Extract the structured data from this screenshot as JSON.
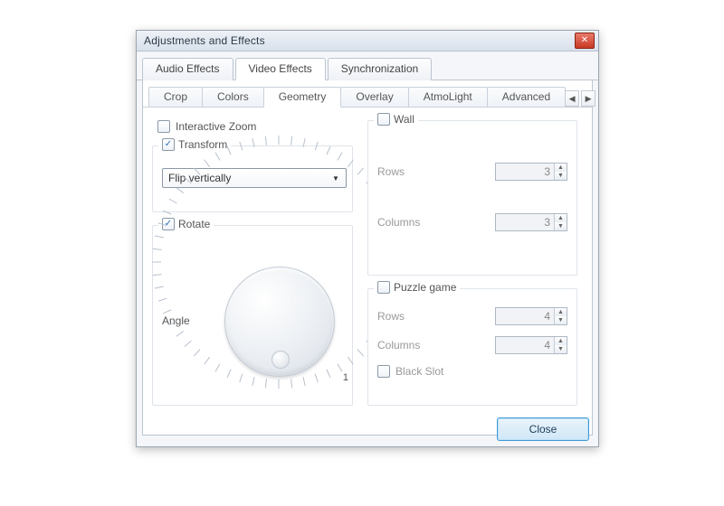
{
  "window": {
    "title": "Adjustments and Effects"
  },
  "tabs_main": {
    "items": [
      "Audio Effects",
      "Video Effects",
      "Synchronization"
    ],
    "active": 1
  },
  "tabs_sub": {
    "items": [
      "Crop",
      "Colors",
      "Geometry",
      "Overlay",
      "AtmoLight",
      "Advanced"
    ],
    "active": 2
  },
  "geometry": {
    "interactive_zoom": {
      "label": "Interactive Zoom",
      "checked": false
    },
    "transform": {
      "label": "Transform",
      "checked": true,
      "mode": "Flip vertically"
    },
    "rotate": {
      "label": "Rotate",
      "checked": true,
      "angle_label": "Angle",
      "tick_label": "1"
    },
    "wall": {
      "label": "Wall",
      "checked": false,
      "rows_label": "Rows",
      "rows_value": "3",
      "cols_label": "Columns",
      "cols_value": "3"
    },
    "puzzle": {
      "label": "Puzzle game",
      "checked": false,
      "rows_label": "Rows",
      "rows_value": "4",
      "cols_label": "Columns",
      "cols_value": "4",
      "black_slot_label": "Black Slot",
      "black_slot_checked": false
    }
  },
  "footer": {
    "close": "Close"
  }
}
